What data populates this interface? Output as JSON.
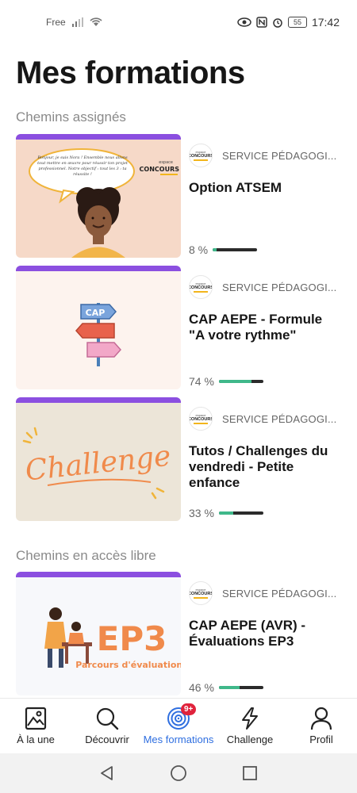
{
  "status_bar": {
    "carrier": "Free",
    "battery": "55",
    "time": "17:42"
  },
  "page": {
    "title": "Mes formations"
  },
  "sections": [
    {
      "title": "Chemins assignés",
      "courses": [
        {
          "thumb_text": "Bonjour, je suis Nora ! Ensemble nous allons tout mettre en œuvre pour réussir ton projet professionnel. Notre objectif : tout les 3 : ta réussite !",
          "provider": "SERVICE PÉDAGOGI...",
          "title": "Option ATSEM",
          "progress_label": "8 %",
          "progress": 8
        },
        {
          "thumb_text": "CAP",
          "provider": "SERVICE PÉDAGOGI...",
          "title": "CAP AEPE - Formule \"A votre rythme\"",
          "progress_label": "74 %",
          "progress": 74
        },
        {
          "thumb_text": "Challenge",
          "provider": "SERVICE PÉDAGOGI...",
          "title": "Tutos / Challenges du vendredi - Petite enfance",
          "progress_label": "33 %",
          "progress": 33
        }
      ]
    },
    {
      "title": "Chemins en accès libre",
      "courses": [
        {
          "thumb_text": "EP3",
          "thumb_subtext": "Parcours d'évaluations",
          "provider": "SERVICE PÉDAGOGI...",
          "title": "CAP AEPE (AVR) - Évaluations EP3",
          "progress_label": "46 %",
          "progress": 46
        }
      ]
    }
  ],
  "logo": {
    "line1": "espace",
    "line2": "CONCOURS"
  },
  "bottom_nav": [
    {
      "label": "À la une",
      "icon": "image-icon"
    },
    {
      "label": "Découvrir",
      "icon": "search-icon"
    },
    {
      "label": "Mes formations",
      "icon": "target-icon",
      "badge": "9+",
      "active": true
    },
    {
      "label": "Challenge",
      "icon": "lightning-icon"
    },
    {
      "label": "Profil",
      "icon": "user-icon"
    }
  ],
  "colors": {
    "accent": "#2f6fe0",
    "thumb_band": "#8b4fe0",
    "progress": "#3fb88a",
    "badge": "#e0233c"
  }
}
